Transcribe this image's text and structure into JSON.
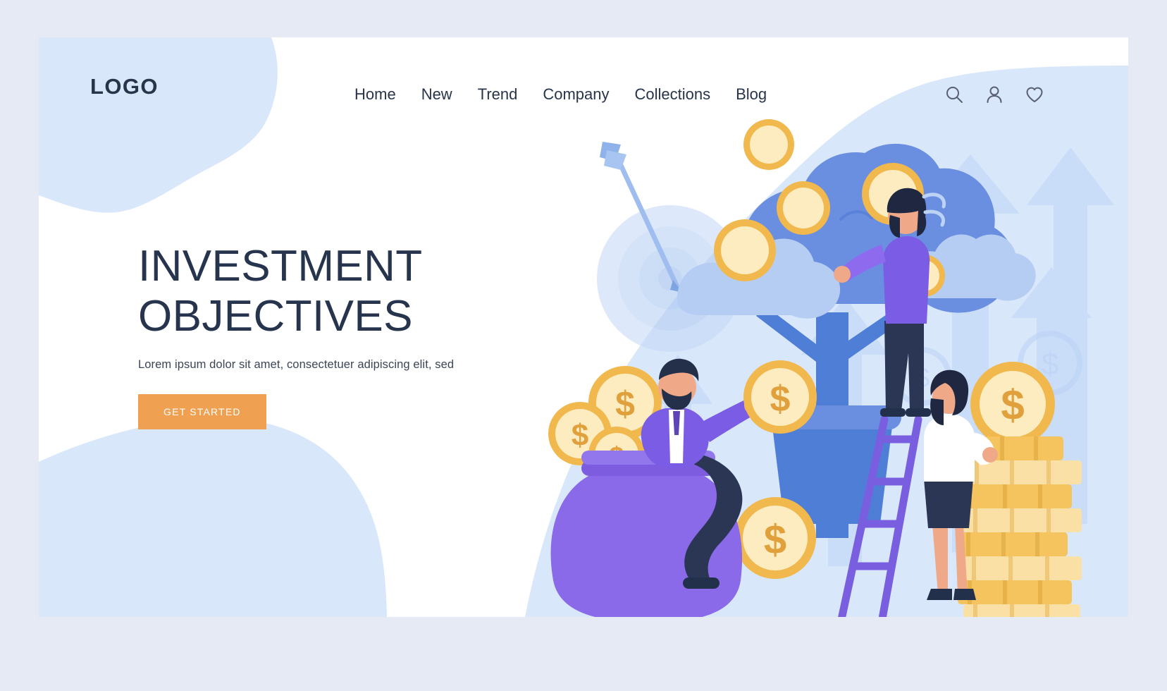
{
  "brand": {
    "logo": "LOGO"
  },
  "nav": {
    "items": [
      {
        "label": "Home"
      },
      {
        "label": "New"
      },
      {
        "label": "Trend"
      },
      {
        "label": "Company"
      },
      {
        "label": "Collections"
      },
      {
        "label": "Blog"
      }
    ]
  },
  "header_icons": [
    {
      "name": "search-icon"
    },
    {
      "name": "user-icon"
    },
    {
      "name": "heart-icon"
    }
  ],
  "hero": {
    "title_line1": "INVESTMENT",
    "title_line2": "OBJECTIVES",
    "subtitle": "Lorem ipsum dolor sit amet, consectetuer adipiscing elit, sed",
    "cta_label": "GET STARTED"
  },
  "illustration": {
    "alt": "money tree with coins, money bag, coin stacks and people",
    "coin_symbol": "$"
  },
  "colors": {
    "page_background": "#e5eaf4",
    "card_background": "#ffffff",
    "blue_panel": "#d9e7fb",
    "accent_orange": "#efa051",
    "text_dark": "#27344a",
    "heading": "#27344e",
    "tree_blue": "#6a8fe0",
    "cloud_blue": "#a8c4f0",
    "bag_purple": "#8a6ae8",
    "coin_gold": "#f5c45e",
    "coin_light": "#fdecc0",
    "arrow_blue": "#c5daf8"
  }
}
